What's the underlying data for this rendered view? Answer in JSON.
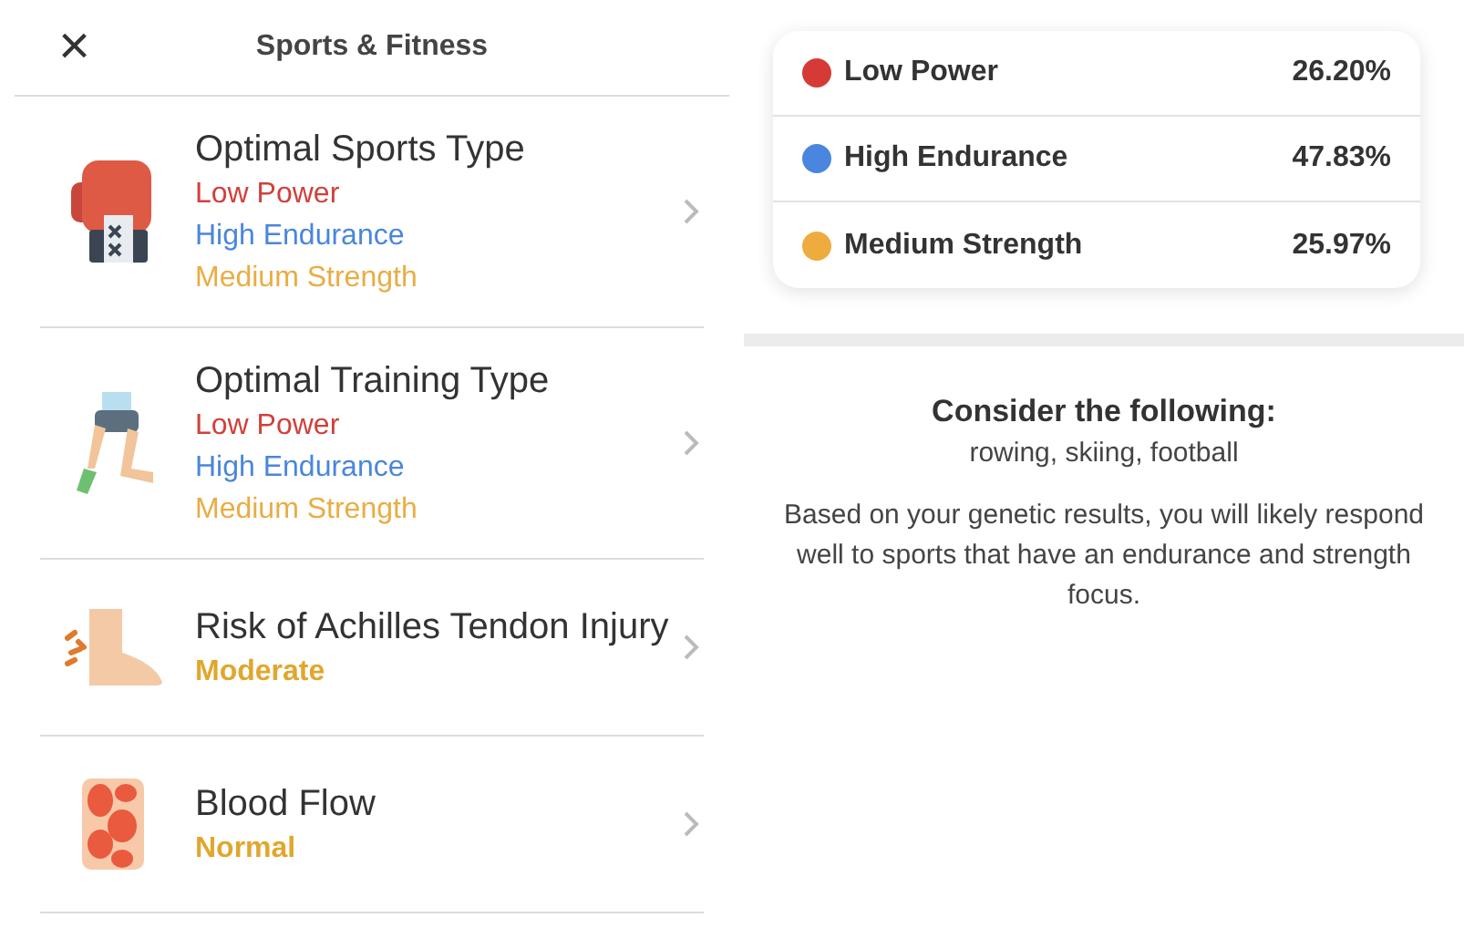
{
  "header": {
    "close": "×",
    "title": "Sports & Fitness"
  },
  "items": [
    {
      "kind": "glove",
      "title": "Optimal Sports Type",
      "lines": [
        {
          "text": "Low Power",
          "color": "#d0413c",
          "bold": false
        },
        {
          "text": "High Endurance",
          "color": "#4a86dc",
          "bold": false
        },
        {
          "text": "Medium Strength",
          "color": "#e9ad44",
          "bold": false
        }
      ]
    },
    {
      "kind": "leg",
      "title": "Optimal Training Type",
      "lines": [
        {
          "text": "Low Power",
          "color": "#d0413c",
          "bold": false
        },
        {
          "text": "High Endurance",
          "color": "#4a86dc",
          "bold": false
        },
        {
          "text": "Medium Strength",
          "color": "#e9ad44",
          "bold": false
        }
      ]
    },
    {
      "kind": "foot",
      "title": "Risk of Achilles Tendon Injury",
      "lines": [
        {
          "text": "Moderate",
          "color": "#e0a72e",
          "bold": true
        }
      ]
    },
    {
      "kind": "blood",
      "title": "Blood Flow",
      "lines": [
        {
          "text": "Normal",
          "color": "#e0a72e",
          "bold": true
        }
      ]
    }
  ],
  "legend": [
    {
      "label": "Low Power",
      "value": "26.20%",
      "color": "#d63a36"
    },
    {
      "label": "High Endurance",
      "value": "47.83%",
      "color": "#4a86e0"
    },
    {
      "label": "Medium Strength",
      "value": "25.97%",
      "color": "#eeab3e"
    }
  ],
  "advice": {
    "heading": "Consider the following:",
    "sports": "rowing, skiing, football",
    "body": "Based on your genetic results, you will likely respond well to sports that have an endurance and strength focus."
  }
}
